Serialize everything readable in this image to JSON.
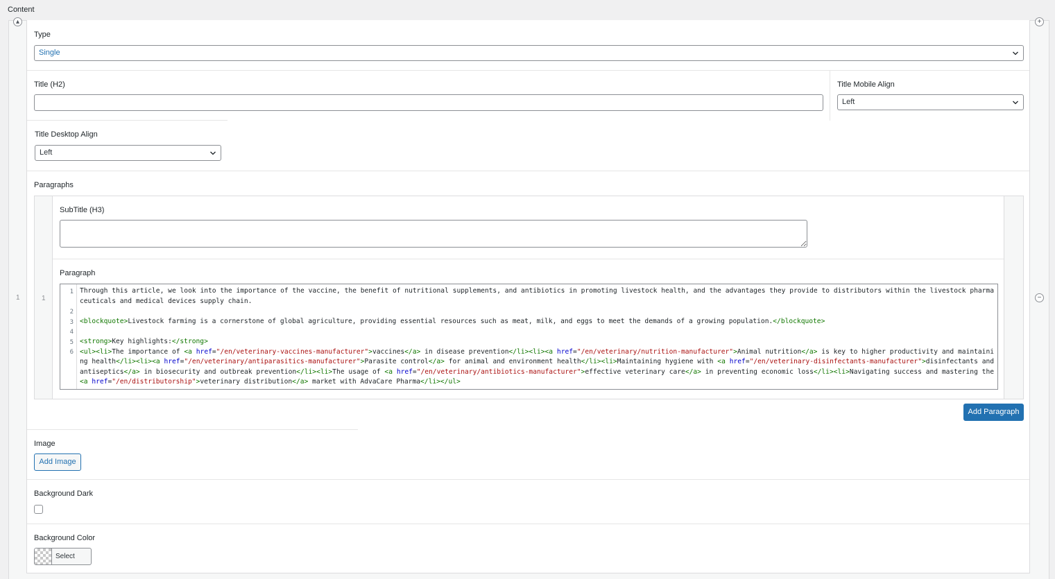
{
  "section": {
    "title": "Content"
  },
  "repeater": {
    "row_number": "1",
    "add_icon": "+",
    "collapse_icon": "▴",
    "remove_icon": "−"
  },
  "type_field": {
    "label": "Type",
    "value": "Single"
  },
  "title_field": {
    "label": "Title (H2)",
    "value": ""
  },
  "title_mobile_align": {
    "label": "Title Mobile Align",
    "value": "Left"
  },
  "title_desktop_align": {
    "label": "Title Desktop Align",
    "value": "Left"
  },
  "paragraphs": {
    "label": "Paragraphs",
    "row_number": "1",
    "subtitle": {
      "label": "SubTitle (H3)",
      "value": ""
    },
    "paragraph": {
      "label": "Paragraph",
      "line_numbers": [
        "1",
        "2",
        "3",
        "4",
        "5",
        "6"
      ],
      "lines": [
        "Through this article, we look into the importance of the vaccine, the benefit of nutritional supplements, and antibiotics in promoting livestock health, and the advantages they provide to distributors within the livestock pharmaceuticals and medical devices supply chain.",
        "",
        "<blockquote>Livestock farming is a cornerstone of global agriculture, providing essential resources such as meat, milk, and eggs to meet the demands of a growing population.</blockquote>",
        "",
        "<strong>Key highlights:</strong>",
        "<ul><li>The importance of <a href=\"/en/veterinary-vaccines-manufacturer\">vaccines</a> in disease prevention</li><li><a href=\"/en/veterinary/nutrition-manufacturer\">Animal nutrition</a> is key to higher productivity and maintaining health</li><li><a href=\"/en/veterinary/antiparasitics-manufacturer\">Parasite control</a> for animal and environment health</li><li>Maintaining hygiene with <a href=\"/en/veterinary-disinfectants-manufacturer\">disinfectants and antiseptics</a> in biosecurity and outbreak prevention</li><li>The usage of <a href=\"/en/veterinary/antibiotics-manufacturer\">effective veterinary care</a> in preventing economic loss</li><li>Navigating success and mastering the <a href=\"/en/distributorship\">veterinary distribution</a> market with AdvaCare Pharma</li></ul>"
      ]
    },
    "add_button": "Add Paragraph"
  },
  "image_field": {
    "label": "Image",
    "button": "Add Image"
  },
  "background_dark": {
    "label": "Background Dark",
    "checked": false
  },
  "background_color": {
    "label": "Background Color",
    "button": "Select Color"
  },
  "colors": {
    "accent": "#2271b1",
    "border": "#8c8f94",
    "panel_bg": "#ffffff",
    "page_bg": "#f0f0f1"
  },
  "icons": {
    "select_arrow": "chevron-down-icon",
    "add_row": "plus-icon",
    "remove_row": "minus-icon",
    "collapse": "collapse-icon"
  }
}
